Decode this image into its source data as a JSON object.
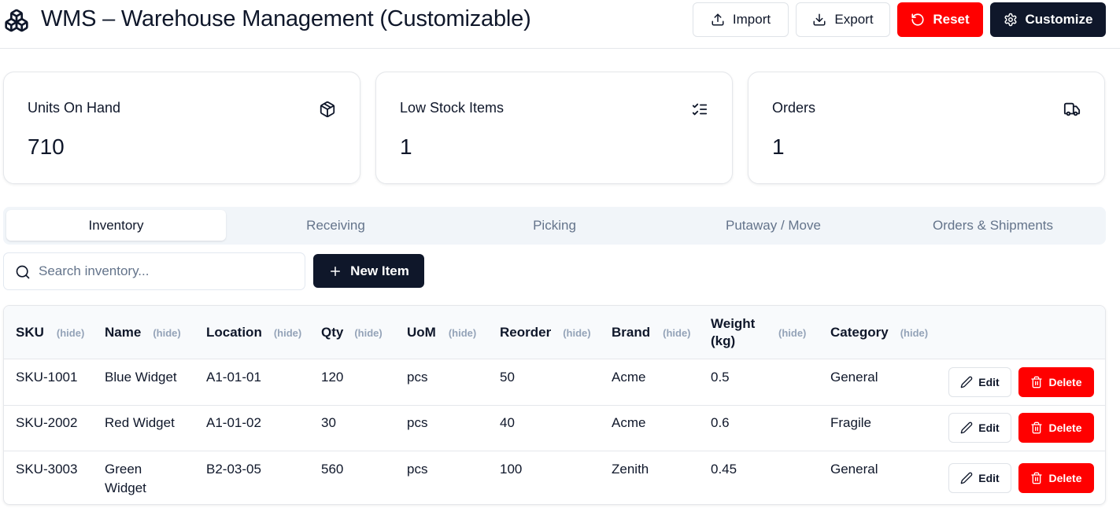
{
  "header": {
    "title": "WMS – Warehouse Management (Customizable)",
    "logo_icon": "boxes-icon",
    "import_label": "Import",
    "export_label": "Export",
    "reset_label": "Reset",
    "customize_label": "Customize"
  },
  "stats": [
    {
      "label": "Units On Hand",
      "value": "710",
      "icon": "package-icon"
    },
    {
      "label": "Low Stock Items",
      "value": "1",
      "icon": "list-checks-icon"
    },
    {
      "label": "Orders",
      "value": "1",
      "icon": "truck-icon"
    }
  ],
  "tabs": [
    {
      "label": "Inventory",
      "active": true
    },
    {
      "label": "Receiving",
      "active": false
    },
    {
      "label": "Picking",
      "active": false
    },
    {
      "label": "Putaway / Move",
      "active": false
    },
    {
      "label": "Orders & Shipments",
      "active": false
    }
  ],
  "search": {
    "placeholder": "Search inventory...",
    "value": ""
  },
  "new_item_label": "New Item",
  "table": {
    "hide_label": "(hide)",
    "columns": [
      "SKU",
      "Name",
      "Location",
      "Qty",
      "UoM",
      "Reorder",
      "Brand",
      "Weight (kg)",
      "Category"
    ],
    "rows": [
      [
        "SKU-1001",
        "Blue Widget",
        "A1-01-01",
        "120",
        "pcs",
        "50",
        "Acme",
        "0.5",
        "General"
      ],
      [
        "SKU-2002",
        "Red Widget",
        "A1-01-02",
        "30",
        "pcs",
        "40",
        "Acme",
        "0.6",
        "Fragile"
      ],
      [
        "SKU-3003",
        "Green Widget",
        "B2-03-05",
        "560",
        "pcs",
        "100",
        "Zenith",
        "0.45",
        "General"
      ]
    ],
    "edit_label": "Edit",
    "delete_label": "Delete"
  },
  "colors": {
    "primary_dark": "#0f172a",
    "danger": "#ff0000",
    "muted": "#64748b"
  }
}
